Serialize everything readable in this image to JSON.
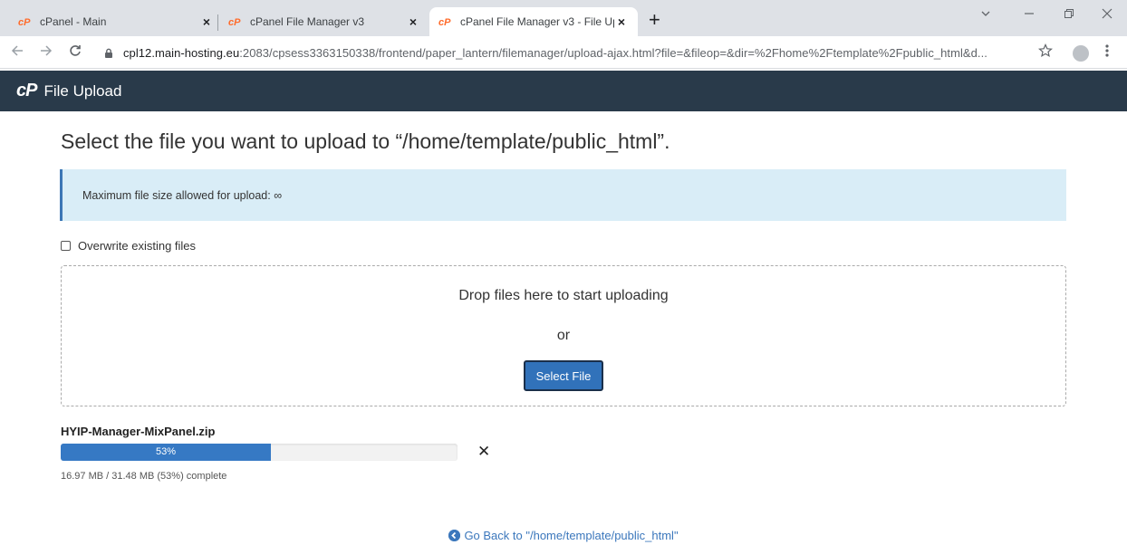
{
  "browser": {
    "tabs": [
      {
        "title": "cPanel - Main",
        "active": false
      },
      {
        "title": "cPanel File Manager v3",
        "active": false
      },
      {
        "title": "cPanel File Manager v3 - File Upl",
        "active": true
      }
    ],
    "new_tab_label": "+",
    "url_host": "cpl12.main-hosting.eu",
    "url_rest": ":2083/cpsess3363150338/frontend/paper_lantern/filemanager/upload-ajax.html?file=&fileop=&dir=%2Fhome%2Ftemplate%2Fpublic_html&d...",
    "icons": {
      "back": "arrow-left-icon",
      "forward": "arrow-right-icon",
      "reload": "reload-icon",
      "lock": "lock-icon",
      "star": "star-icon",
      "profile": "profile-icon",
      "menu": "kebab-menu-icon",
      "minimize": "minimize-icon",
      "maximize": "maximize-icon",
      "close": "close-icon",
      "tab_list": "chevron-down-icon"
    }
  },
  "app": {
    "logo": "cP",
    "title": "File Upload",
    "header_color": "#293a4a"
  },
  "main": {
    "heading": "Select the file you want to upload to “/home/template/public_html”.",
    "alert_text": "Maximum file size allowed for upload: ∞",
    "overwrite_label": "Overwrite existing files",
    "overwrite_checked": false,
    "dropzone_text": "Drop files here to start uploading",
    "or_text": "or",
    "select_button": "Select File",
    "upload": {
      "file_name": "HYIP-Manager-MixPanel.zip",
      "progress_percent": 53,
      "progress_label": "53%",
      "status": "16.97 MB / 31.48 MB (53%) complete",
      "cancel_symbol": "✕"
    },
    "go_back": "Go Back to \"/home/template/public_html\""
  }
}
